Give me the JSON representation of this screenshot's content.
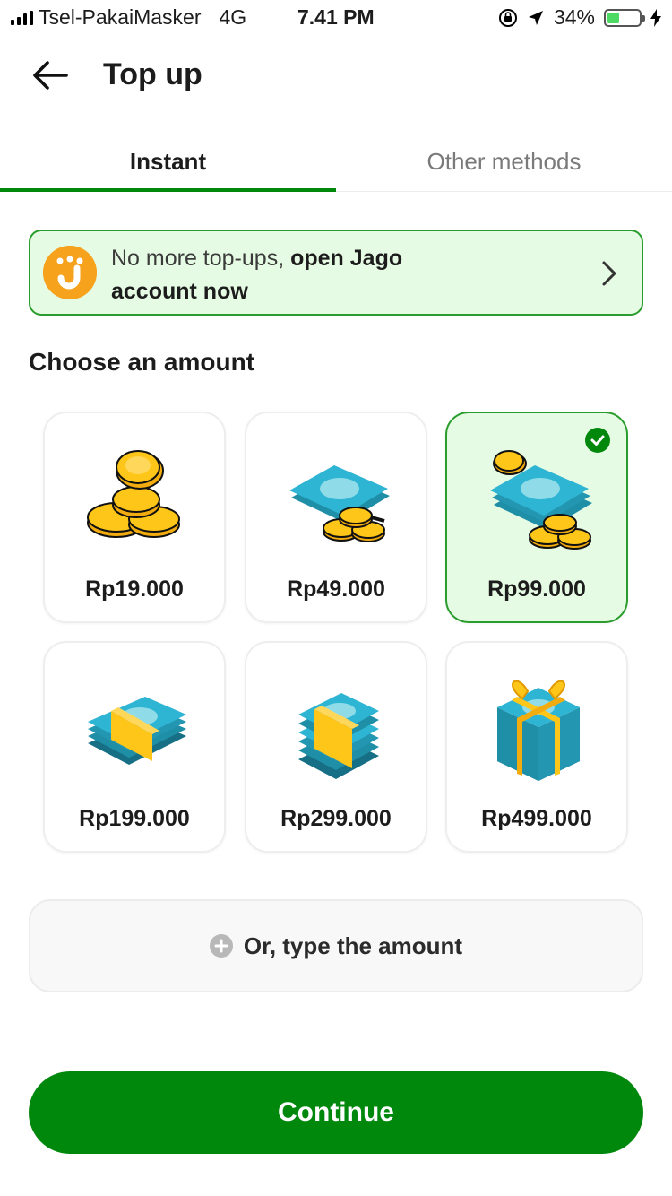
{
  "status_bar": {
    "carrier": "Tsel-PakaiMasker",
    "network": "4G",
    "time": "7.41 PM",
    "battery": "34%",
    "battery_level": 0.34
  },
  "header": {
    "title": "Top up",
    "back_icon": "arrow-left-icon"
  },
  "tabs": [
    {
      "label": "Instant",
      "active": true
    },
    {
      "label": "Other methods",
      "active": false
    }
  ],
  "banner": {
    "text_regular": "No more top-ups,",
    "text_bold_1": "open Jago",
    "text_bold_2": "account now",
    "icon": "jago-logo-icon"
  },
  "section_title": "Choose an amount",
  "amounts": [
    {
      "label": "Rp19.000",
      "icon": "coins-icon",
      "selected": false
    },
    {
      "label": "Rp49.000",
      "icon": "bill-coins-icon",
      "selected": false
    },
    {
      "label": "Rp99.000",
      "icon": "bills-coins-icon",
      "selected": true
    },
    {
      "label": "Rp199.000",
      "icon": "money-bundle-icon",
      "selected": false
    },
    {
      "label": "Rp299.000",
      "icon": "money-stack-icon",
      "selected": false
    },
    {
      "label": "Rp499.000",
      "icon": "money-gift-icon",
      "selected": false
    }
  ],
  "type_amount": {
    "label": "Or, type the amount",
    "icon": "plus-circle-icon"
  },
  "continue_label": "Continue",
  "colors": {
    "primary_green": "#00880d",
    "selected_bg": "#e6fbe3",
    "jago_orange": "#f6a21c",
    "coin_gold": "#ffc61a",
    "bill_teal": "#2fb5d4"
  }
}
